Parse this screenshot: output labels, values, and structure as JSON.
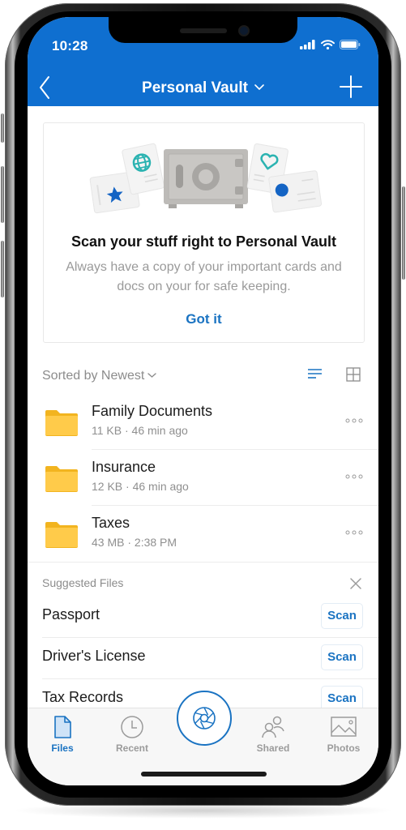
{
  "status_bar": {
    "time": "10:28",
    "icons": [
      "cellular-signal-icon",
      "wifi-icon",
      "battery-icon"
    ]
  },
  "nav": {
    "back_icon": "chevron-left-icon",
    "title": "Personal Vault",
    "title_dropdown_icon": "chevron-down-icon",
    "add_icon": "plus-icon"
  },
  "colors": {
    "brand_blue": "#0f6fd0",
    "link_blue": "#1a73c2",
    "folder_yellow": "#ffc83d",
    "muted_text": "#8c8c8c"
  },
  "promo": {
    "illustration": "vault-safe-with-documents-illustration",
    "title": "Scan your stuff right to Personal Vault",
    "body": "Always have a copy of your important cards and docs on your for safe keeping.",
    "action": "Got it"
  },
  "sort": {
    "label": "Sorted by Newest",
    "view_modes": [
      {
        "name": "list-view",
        "icon": "list-view-icon",
        "active": true
      },
      {
        "name": "grid-view",
        "icon": "grid-view-icon",
        "active": false
      }
    ]
  },
  "files": [
    {
      "name": "Family Documents",
      "meta": "11 KB · 46 min ago",
      "type": "folder"
    },
    {
      "name": "Insurance",
      "meta": "12 KB · 46 min ago",
      "type": "folder"
    },
    {
      "name": "Taxes",
      "meta": "43 MB · 2:38 PM",
      "type": "folder"
    }
  ],
  "suggested": {
    "heading": "Suggested Files",
    "close_icon": "close-icon",
    "items": [
      {
        "name": "Passport",
        "action": "Scan"
      },
      {
        "name": "Driver's License",
        "action": "Scan"
      },
      {
        "name": "Tax Records",
        "action": "Scan"
      }
    ]
  },
  "tabbar": {
    "tabs": [
      {
        "label": "Files",
        "icon": "file-icon",
        "active": true
      },
      {
        "label": "Recent",
        "icon": "clock-icon",
        "active": false
      },
      {
        "label": "Shared",
        "icon": "people-icon",
        "active": false
      },
      {
        "label": "Photos",
        "icon": "image-icon",
        "active": false
      }
    ],
    "scan_button_icon": "camera-shutter-icon"
  }
}
